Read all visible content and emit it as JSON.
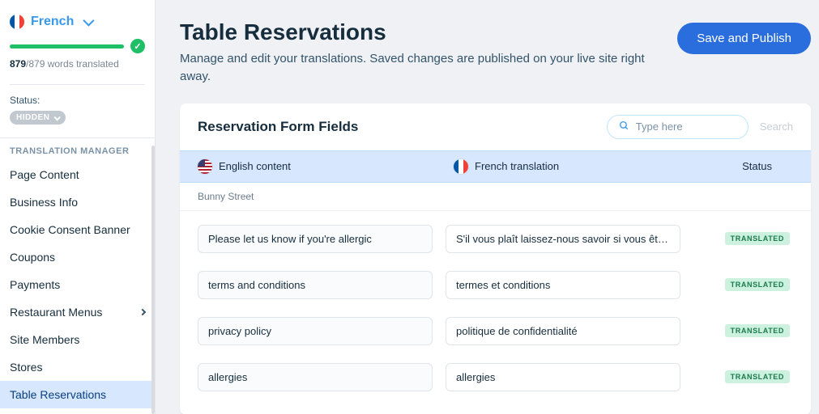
{
  "sidebar": {
    "language_label": "French",
    "progress": {
      "done": "879",
      "total": "/879 words translated"
    },
    "status_label": "Status:",
    "hidden_label": "HIDDEN",
    "section_title": "TRANSLATION MANAGER",
    "items": [
      {
        "label": "Page Content"
      },
      {
        "label": "Business Info"
      },
      {
        "label": "Cookie Consent Banner"
      },
      {
        "label": "Coupons"
      },
      {
        "label": "Payments"
      },
      {
        "label": "Restaurant Menus",
        "has_sub": true
      },
      {
        "label": "Site Members"
      },
      {
        "label": "Stores"
      },
      {
        "label": "Table Reservations",
        "active": true
      }
    ]
  },
  "header": {
    "title": "Table Reservations",
    "subtitle": "Manage and edit your translations. Saved changes are published on your live site right away.",
    "publish": "Save and Publish"
  },
  "card": {
    "title": "Reservation Form Fields",
    "search_placeholder": "Type here",
    "search_action": "Search",
    "columns": {
      "source": "English content",
      "target": "French translation",
      "status": "Status"
    },
    "group": "Bunny Street",
    "rows": [
      {
        "source": "Please let us know if you're allergic",
        "target": "S'il vous plaît laissez-nous savoir si vous ête…",
        "status": "TRANSLATED"
      },
      {
        "source": "terms and conditions",
        "target": "termes et conditions",
        "status": "TRANSLATED"
      },
      {
        "source": "privacy policy",
        "target": "politique de confidentialité",
        "status": "TRANSLATED"
      },
      {
        "source": "allergies",
        "target": "allergies",
        "status": "TRANSLATED"
      }
    ]
  }
}
